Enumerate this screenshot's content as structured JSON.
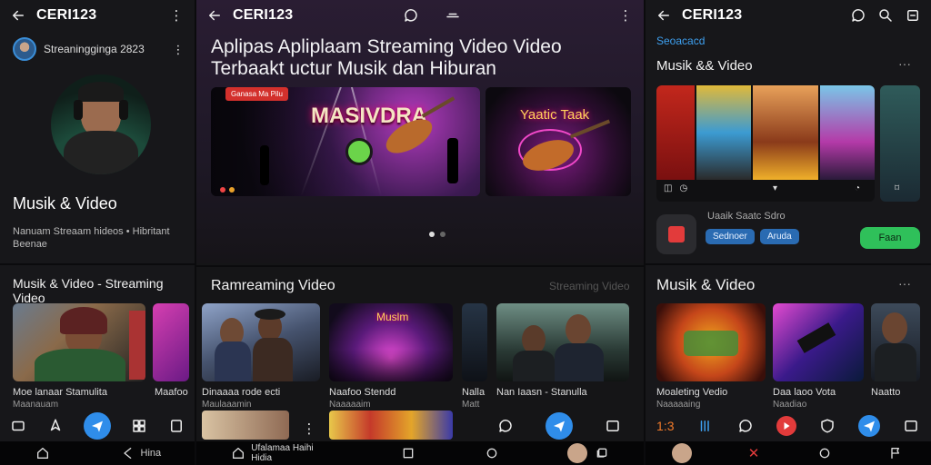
{
  "panel1": {
    "title": "CERI123",
    "channel_name": "Streaningginga 2823",
    "heading": "Musik & Video",
    "description": "Nanuam Streaam hideos • Hibritant Beenae",
    "section_title": "Musik & Video - Streaming Video",
    "card_label": "Moe lanaar Stamulita",
    "card_sublabel": "Maanauam",
    "card2_label": "Maafoo",
    "nav_back_label": "Hina"
  },
  "panel2": {
    "title": "CERI123",
    "hero_title": "Aplipas Apliplaam Streaming Video Video Terbaakt uctur Musik dan Hiburan",
    "banner_badge": "Ganasa Ma Pilu",
    "banner1_text": "MASIVDRA",
    "banner2_text": "Yaatic Taak",
    "section_title": "Ramreaming Video",
    "section_right": "Streaming Video",
    "cards": [
      {
        "label": "Dinaaaa rode ecti",
        "sub": "Maulaaamin"
      },
      {
        "label": "Naafoo Stendd",
        "sub": "Naaaaaim"
      },
      {
        "label": "Nalla",
        "sub": "Matt"
      },
      {
        "label": "Nan Iaasn - Stanulla",
        "sub": ""
      }
    ],
    "card1_thumb_text": "",
    "card2_thumb_text": "Muslm",
    "row2_card_text": "Ufalamaa Haihi Hidia"
  },
  "panel3": {
    "title": "CERI123",
    "link_text": "Seoacacd",
    "section1_title": "Musik && Video",
    "app_name": "Uaaik Saatc Sdro",
    "tag1": "Sednoer",
    "tag2": "Aruda",
    "open_button": "Faan",
    "section2_title": "Musik & Video",
    "cards": [
      {
        "label": "Moaleting Vedio",
        "sub": "Naaaaaing"
      },
      {
        "label": "Daa laoo Vota",
        "sub": "Naadiao"
      },
      {
        "label": "Naatto",
        "sub": ""
      }
    ],
    "nav_count": "1:3"
  }
}
